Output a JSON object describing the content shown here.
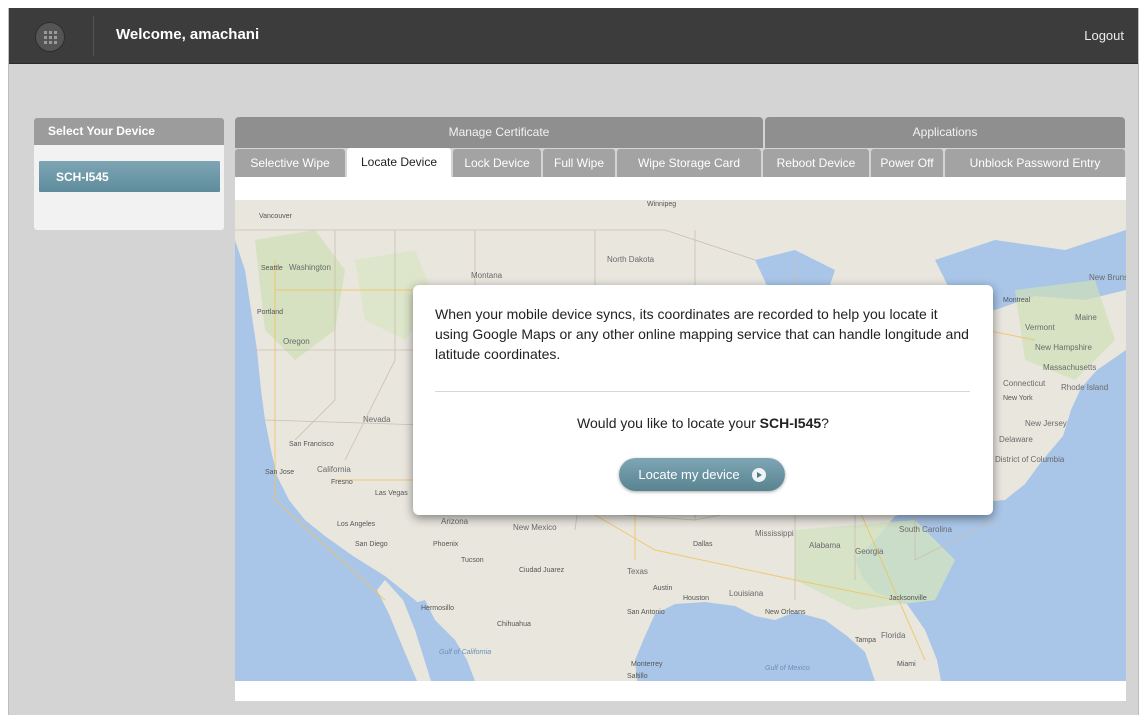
{
  "header": {
    "welcome": "Welcome, amachani",
    "logout": "Logout"
  },
  "sidebar": {
    "title": "Select Your Device",
    "devices": [
      "SCH-I545"
    ]
  },
  "tab_groups": [
    "Manage Certificate",
    "Applications"
  ],
  "tabs": [
    "Selective Wipe",
    "Locate Device",
    "Lock Device",
    "Full Wipe",
    "Wipe Storage Card",
    "Reboot Device",
    "Power Off",
    "Unblock Password Entry"
  ],
  "active_tab": "Locate Device",
  "modal": {
    "text": "When your mobile device syncs, its coordinates are recorded to help you locate it using Google Maps or any other online mapping service that can handle longitude and latitude coordinates.",
    "question_prefix": "Would you like to locate your ",
    "device": "SCH-I545",
    "question_suffix": "?",
    "button_label": "Locate my device"
  },
  "map_labels": {
    "cities": [
      "Vancouver",
      "Seattle",
      "Portland",
      "San Francisco",
      "San Jose",
      "Fresno",
      "Las Vegas",
      "Los Angeles",
      "San Diego",
      "Phoenix",
      "Tucson",
      "Ciudad Juarez",
      "Hermosillo",
      "Chihuahua",
      "Monterrey",
      "Saltillo",
      "Dallas",
      "Austin",
      "Houston",
      "San Antonio",
      "New Orleans",
      "Jacksonville",
      "Tampa",
      "Miami",
      "Winnipeg",
      "Montreal",
      "New York"
    ],
    "regions": [
      "Washington",
      "Oregon",
      "Montana",
      "North Dakota",
      "Nevada",
      "California",
      "Arizona",
      "New Mexico",
      "Texas",
      "Louisiana",
      "Mississippi",
      "Alabama",
      "Georgia",
      "Florida",
      "South Carolina",
      "Vermont",
      "New Hampshire",
      "Massachusetts",
      "Connecticut",
      "Rhode Island",
      "Maine",
      "New Jersey",
      "Delaware",
      "District of Columbia",
      "New Brunswick"
    ],
    "waters": [
      "Gulf of California",
      "Gulf of Mexico"
    ]
  },
  "colors": {
    "topbar": "#3c3c3c",
    "accent": "#6a96a6",
    "tab_inactive": "#a3a3a3",
    "tab_group": "#8f8f8f",
    "background": "#d4d4d4"
  }
}
